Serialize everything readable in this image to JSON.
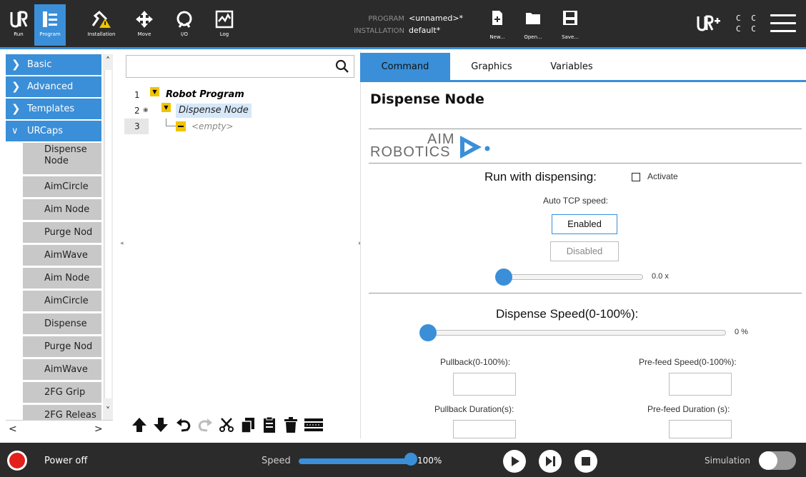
{
  "header": {
    "tools": [
      {
        "id": "run",
        "label": "Run",
        "icon": "ur-logo-icon"
      },
      {
        "id": "program",
        "label": "Program",
        "icon": "program-icon"
      },
      {
        "id": "installation",
        "label": "Installation",
        "icon": "installation-warning-icon"
      },
      {
        "id": "move",
        "label": "Move",
        "icon": "move-arrows-icon"
      },
      {
        "id": "io",
        "label": "I/O",
        "icon": "io-icon"
      },
      {
        "id": "log",
        "label": "Log",
        "icon": "log-chart-icon"
      }
    ],
    "active_tool": "program",
    "program_key": "PROGRAM",
    "program_value": "<unnamed>*",
    "installation_key": "INSTALLATION",
    "installation_value": "default*",
    "file_buttons": {
      "new": "New...",
      "open": "Open...",
      "save": "Save..."
    },
    "cc_lines": [
      "C C",
      "C C"
    ]
  },
  "sidebar": {
    "categories": [
      {
        "label": "Basic",
        "chevron": ">"
      },
      {
        "label": "Advanced",
        "chevron": ">"
      },
      {
        "label": "Templates",
        "chevron": ">"
      },
      {
        "label": "URCaps",
        "chevron": "v"
      }
    ],
    "items": [
      "Dispense Node",
      "AimCircle",
      "Aim Node",
      "Purge Nod",
      "AimWave",
      "Aim Node",
      "AimCircle",
      "Dispense",
      "Purge Nod",
      "AimWave",
      "2FG Grip",
      "2FG Releas"
    ],
    "nav_left": "<",
    "nav_right": ">"
  },
  "tree": {
    "search_placeholder": "",
    "rows": [
      {
        "line": "1",
        "label": "Robot Program"
      },
      {
        "line": "2",
        "label": "Dispense Node"
      },
      {
        "line": "3",
        "label": "<empty>"
      }
    ]
  },
  "panel": {
    "tabs": [
      "Command",
      "Graphics",
      "Variables"
    ],
    "active_tab": "Command",
    "title": "Dispense Node",
    "logo": {
      "top": "AIM",
      "bottom": "ROBOTICS",
      "accent": "#3a8fd8"
    },
    "run_with_dispensing": "Run with dispensing:",
    "activate_label": "Activate",
    "activate_checked": false,
    "auto_tcp_label": "Auto TCP speed:",
    "enabled_label": "Enabled",
    "disabled_label": "Disabled",
    "tcp_slider_value": "0.0 x",
    "dispense_speed_label": "Dispense Speed(0-100%):",
    "dispense_slider_value": "0 %",
    "pullback_label": "Pullback(0-100%):",
    "prefeed_speed_label": "Pre-feed Speed(0-100%):",
    "pullback_duration_label": "Pullback Duration(s):",
    "prefeed_duration_label": "Pre-feed Duration (s):"
  },
  "footer": {
    "power_label": "Power off",
    "speed_label": "Speed",
    "speed_value": "100%",
    "speed_fraction": 1.0,
    "simulation_label": "Simulation",
    "simulation_on": false
  },
  "colors": {
    "accent": "#3a8fd8",
    "header_bg": "#2b2b2b",
    "power_red": "#e3201b",
    "node_yellow": "#f0c400"
  }
}
